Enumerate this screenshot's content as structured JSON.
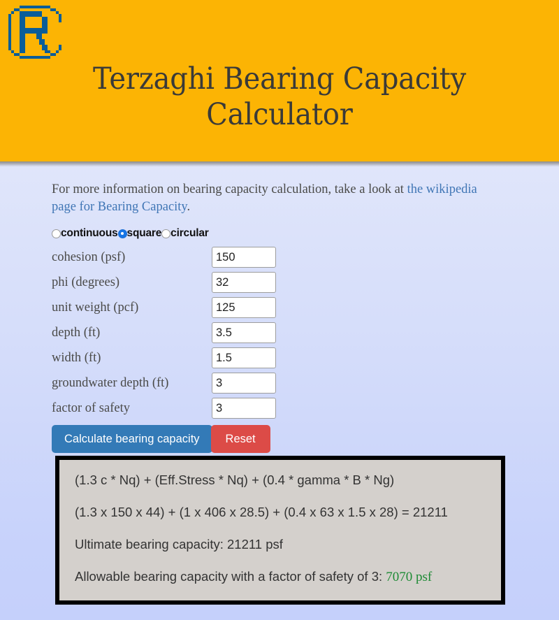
{
  "header": {
    "title": "Terzaghi Bearing Capacity Calculator",
    "logo_name": "pixel-r-logo",
    "bg_color": "#fcb404",
    "title_color": "#3a3a38"
  },
  "intro": {
    "text_before": "For more information on bearing capacity calculation, take a look at ",
    "link_text": "the wikipedia page for Bearing Capacity",
    "text_after": ".",
    "link_color": "#4076b5"
  },
  "shape": {
    "selected": "square",
    "options": [
      {
        "value": "continuous",
        "label": "continuous",
        "checked": false
      },
      {
        "value": "square",
        "label": "square",
        "checked": true
      },
      {
        "value": "circular",
        "label": "circular",
        "checked": false
      }
    ]
  },
  "form": {
    "fields": [
      {
        "label": "cohesion (psf)",
        "value": "150"
      },
      {
        "label": "phi (degrees)",
        "value": "32"
      },
      {
        "label": "unit weight (pcf)",
        "value": "125"
      },
      {
        "label": "depth (ft)",
        "value": "3.5"
      },
      {
        "label": "width (ft)",
        "value": "1.5"
      },
      {
        "label": "groundwater depth (ft)",
        "value": "3"
      },
      {
        "label": "factor of safety",
        "value": "3"
      }
    ]
  },
  "buttons": {
    "calculate_label": "Calculate bearing capacity",
    "calculate_color": "#337ab7",
    "reset_label": "Reset",
    "reset_color": "#dc4b47"
  },
  "result": {
    "formula": "(1.3 c * Nq) + (Eff.Stress * Nq) + (0.4 * gamma * B * Ng)",
    "substitution": "(1.3 x 150 x 44) + (1 x 406 x 28.5) + (0.4 x 63 x 1.5 x 28) = 21211",
    "ultimate": "Ultimate bearing capacity: 21211 psf",
    "allowable_prefix": "Allowable bearing capacity with a factor of safety of 3: ",
    "allowable_value": "7070 psf",
    "allowable_color": "#1d8a34",
    "bg_color": "#d4d0cc",
    "border_color": "#000000"
  }
}
